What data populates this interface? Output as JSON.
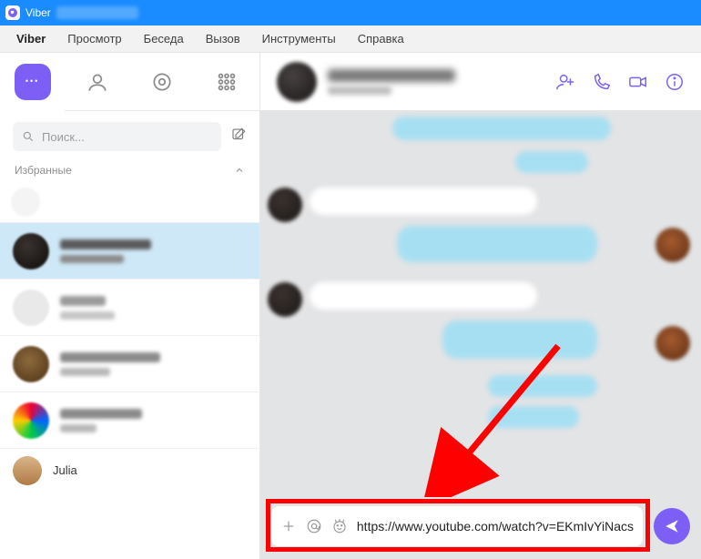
{
  "titlebar": {
    "app_name": "Viber"
  },
  "menubar": {
    "items": [
      "Viber",
      "Просмотр",
      "Беседа",
      "Вызов",
      "Инструменты",
      "Справка"
    ]
  },
  "sidebar": {
    "search_placeholder": "Поиск...",
    "favorites_label": "Избранные",
    "tabs": {
      "chats": "chats",
      "contacts": "contacts",
      "discover": "discover",
      "more": "more"
    },
    "chats": [
      {
        "name_visible": false
      },
      {
        "name_visible": false
      },
      {
        "name_visible": false
      },
      {
        "name_visible": false
      },
      {
        "name_visible": true,
        "name": "Julia"
      }
    ]
  },
  "chat": {
    "header_actions": [
      "add-contact",
      "call",
      "video-call",
      "info"
    ],
    "input_value": "https://www.youtube.com/watch?v=EKmIvYiNacs"
  },
  "colors": {
    "accent": "#7d5ff5",
    "titlebar": "#1a8cff",
    "outgoing_bubble": "#a7dff2",
    "annotation": "#ff0000"
  },
  "annotation": {
    "type": "arrow-and-box",
    "description": "Red arrow pointing to message input field, red rectangle highlighting it"
  }
}
